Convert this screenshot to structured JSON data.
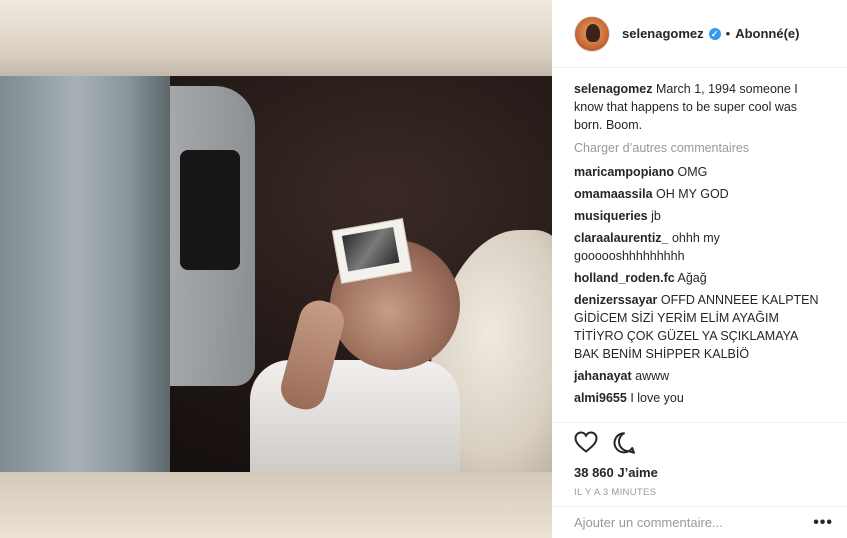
{
  "post": {
    "username": "selenagomez",
    "verified_symbol": "✓",
    "separator": "•",
    "follow_label": "Abonné(e)",
    "caption": "March 1, 1994 someone I know that happens to be super cool was born. Boom.",
    "load_more_label": "Charger d’autres commentaires",
    "comments": [
      {
        "user": "maricampopiano",
        "text": "OMG"
      },
      {
        "user": "omamaassila",
        "text": "OH MY GOD"
      },
      {
        "user": "musiqueries",
        "text": "jb"
      },
      {
        "user": "claraalaurentiz_",
        "text": "ohhh my goooooshhhhhhhhh"
      },
      {
        "user": "holland_roden.fc",
        "text": "Ağağ"
      },
      {
        "user": "denizerssayar",
        "text": "OFFD ANNNEEE KALPTEN GİDİCEM SİZİ YERİM ELİM AYAĞIM TİTİYRO ÇOK GÜZEL YA SÇIKLAMAYA BAK BENİM SHİPPER KALBİÖ"
      },
      {
        "user": "jahanayat",
        "text": "awww"
      },
      {
        "user": "almi9655",
        "text": "I love you"
      }
    ],
    "likes_label": "38 860 J’aime",
    "time_label": "IL Y A 3 MINUTES",
    "add_comment_placeholder": "Ajouter un commentaire...",
    "more_label": "•••",
    "icons": {
      "like": "heart-icon",
      "comment": "comment-icon",
      "verified": "verified-badge-icon",
      "more": "more-options-icon"
    },
    "colors": {
      "verified": "#3897f0",
      "text": "#262626",
      "muted": "#999999",
      "border": "#efefef"
    }
  }
}
